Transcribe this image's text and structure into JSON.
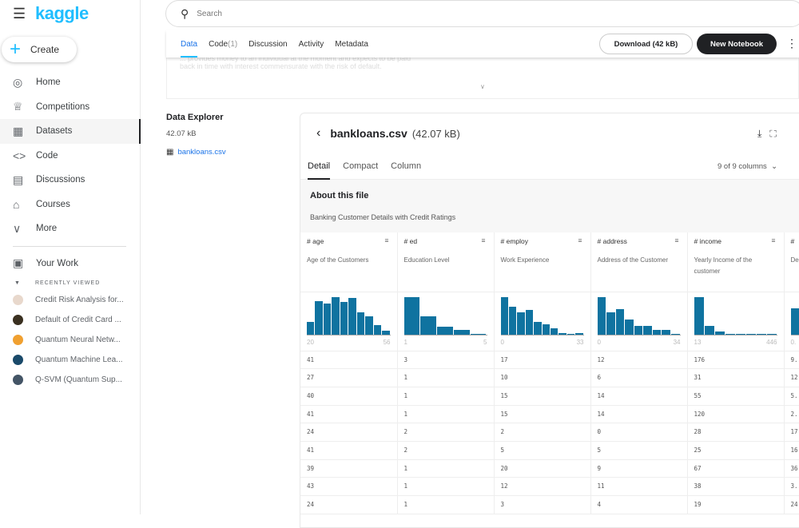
{
  "app": {
    "logo": "kaggle",
    "create": "Create"
  },
  "nav": [
    {
      "icon": "compass-icon",
      "g": "◎",
      "label": "Home"
    },
    {
      "icon": "trophy-icon",
      "g": "♕",
      "label": "Competitions"
    },
    {
      "icon": "table-icon",
      "g": "▦",
      "label": "Datasets",
      "active": true
    },
    {
      "icon": "code-icon",
      "g": "<>",
      "label": "Code"
    },
    {
      "icon": "discussion-icon",
      "g": "▤",
      "label": "Discussions"
    },
    {
      "icon": "school-icon",
      "g": "⌂",
      "label": "Courses"
    },
    {
      "icon": "chevron-down-icon",
      "g": "∨",
      "label": "More"
    }
  ],
  "your_work": "Your Work",
  "recently_viewed": {
    "title": "RECENTLY VIEWED",
    "items": [
      {
        "label": "Credit Risk Analysis for...",
        "color": "#e8d8cc"
      },
      {
        "label": "Default of Credit Card ...",
        "color": "#3a3020"
      },
      {
        "label": "Quantum Neural Netw...",
        "color": "#f0a030"
      },
      {
        "label": "Quantum Machine Lea...",
        "color": "#1a4a6a"
      },
      {
        "label": "Q-SVM (Quantum Sup...",
        "color": "#445566"
      }
    ]
  },
  "search": {
    "placeholder": "Search"
  },
  "tabs": [
    {
      "label": "Data",
      "active": true
    },
    {
      "label": "Code",
      "count": "(1)"
    },
    {
      "label": "Discussion"
    },
    {
      "label": "Activity"
    },
    {
      "label": "Metadata"
    }
  ],
  "actions": {
    "download": "Download (42 kB)",
    "new_notebook": "New Notebook"
  },
  "faded_text": [
    "... provides money to an individual at the moment and expects to be paid",
    "back in time with interest commensurate with the risk of default."
  ],
  "explorer": {
    "title": "Data Explorer",
    "size": "42.07 kB",
    "file": "bankloans.csv"
  },
  "panel": {
    "filename": "bankloans.csv",
    "filesize": "(42.07 kB)",
    "views": [
      "Detail",
      "Compact",
      "Column"
    ],
    "columns_count": "9 of 9 columns",
    "about_title": "About this file",
    "about_desc": "Banking Customer Details with Credit Ratings"
  },
  "columns": [
    {
      "name": "age",
      "desc": "Age of the Customers",
      "min": "20",
      "max": "56",
      "hist": [
        47,
        127,
        117,
        143,
        123,
        137,
        83,
        68,
        35,
        15
      ]
    },
    {
      "name": "ed",
      "desc": "Education Level",
      "min": "1",
      "max": "5",
      "hist": [
        142,
        70,
        28,
        18,
        2
      ]
    },
    {
      "name": "employ",
      "desc": "Work Experience",
      "min": "0",
      "max": "33",
      "hist": [
        142,
        105,
        85,
        93,
        48,
        37,
        23,
        6,
        3,
        5
      ]
    },
    {
      "name": "address",
      "desc": "Address of the Customer",
      "min": "0",
      "max": "34",
      "hist": [
        142,
        83,
        95,
        55,
        33,
        33,
        17,
        17,
        3
      ]
    },
    {
      "name": "income",
      "desc": "Yearly Income of the customer",
      "min": "13",
      "max": "446",
      "hist": [
        142,
        32,
        10,
        3,
        1,
        2,
        1,
        1
      ]
    },
    {
      "name": "",
      "desc": "De",
      "min": "0.",
      "max": "",
      "hist": [
        100
      ]
    }
  ],
  "rows": [
    [
      "41",
      "3",
      "17",
      "12",
      "176",
      "9."
    ],
    [
      "27",
      "1",
      "10",
      "6",
      "31",
      "12"
    ],
    [
      "40",
      "1",
      "15",
      "14",
      "55",
      "5."
    ],
    [
      "41",
      "1",
      "15",
      "14",
      "120",
      "2."
    ],
    [
      "24",
      "2",
      "2",
      "0",
      "28",
      "17"
    ],
    [
      "41",
      "2",
      "5",
      "5",
      "25",
      "16"
    ],
    [
      "39",
      "1",
      "20",
      "9",
      "67",
      "36"
    ],
    [
      "43",
      "1",
      "12",
      "11",
      "38",
      "3."
    ],
    [
      "24",
      "1",
      "3",
      "4",
      "19",
      "24"
    ]
  ]
}
